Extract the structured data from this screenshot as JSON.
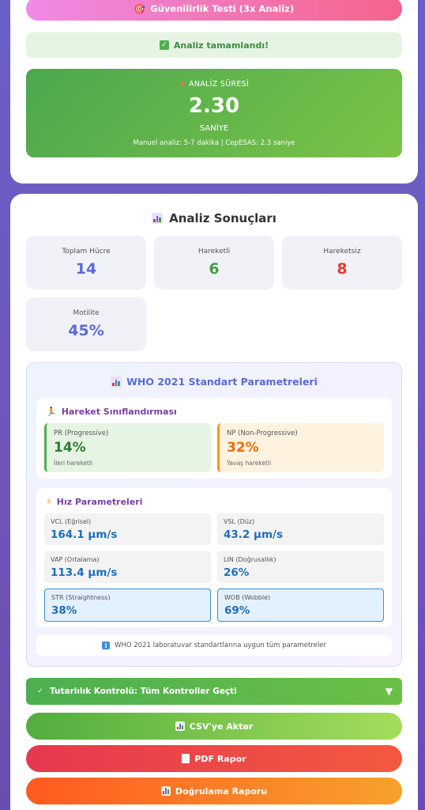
{
  "top": {
    "test_button": "Güvenilirlik Testi (3x Analiz)",
    "success_message": "Analiz tamamlandı!",
    "timer": {
      "label": "ANALİZ SÜRESİ",
      "value": "2.30",
      "unit": "SANİYE",
      "note": "Manuel analiz: 5-7 dakika | CepESAS: 2.3 saniye"
    }
  },
  "results": {
    "title": "Analiz Sonuçları",
    "stats": [
      {
        "label": "Toplam Hücre",
        "value": "14",
        "color": "#5b6bd6"
      },
      {
        "label": "Hareketli",
        "value": "6",
        "color": "#43a047"
      },
      {
        "label": "Hareketsiz",
        "value": "8",
        "color": "#e53935"
      },
      {
        "label": "Motilite",
        "value": "45%",
        "color": "#5b6bd6"
      }
    ],
    "who": {
      "title": "WHO 2021 Standart Parametreleri",
      "movement": {
        "title": "Hareket Sınıflandırması",
        "pr": {
          "label": "PR (Progressive)",
          "value": "14%",
          "sub": "İleri hareketli"
        },
        "np": {
          "label": "NP (Non-Progressive)",
          "value": "32%",
          "sub": "Yavaş hareketli"
        }
      },
      "speed": {
        "title": "Hız Parametreleri",
        "items": [
          {
            "label": "VCL (Eğrisel)",
            "value": "164.1 μm/s"
          },
          {
            "label": "VSL (Düz)",
            "value": "43.2 μm/s"
          },
          {
            "label": "VAP (Ortalama)",
            "value": "113.4 μm/s"
          },
          {
            "label": "LIN (Doğrusallık)",
            "value": "26%"
          },
          {
            "label": "STR (Straightness)",
            "value": "38%"
          },
          {
            "label": "WOB (Wobble)",
            "value": "69%"
          }
        ]
      },
      "info": "WHO 2021 laboratuvar standartlarına uygun tüm parametreler"
    },
    "consistency": "Tutarlılık Kontrolü: Tüm Kontroller Geçti",
    "buttons": {
      "csv": "CSV'ye Aktar",
      "pdf": "PDF Rapor",
      "validation": "Doğrulama Raporu"
    }
  }
}
